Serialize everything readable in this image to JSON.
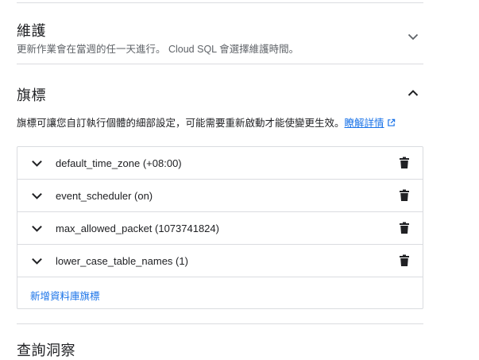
{
  "maintenance": {
    "title": "維護",
    "description": "更新作業會在當週的任一天進行。 Cloud SQL 會選擇維護時間。"
  },
  "flags": {
    "title": "旗標",
    "description": "旗標可讓您自訂執行個體的細部設定，可能需要重新啟動才能使變更生效。",
    "learn_more": "瞭解詳情",
    "items": [
      {
        "label": "default_time_zone (+08:00)"
      },
      {
        "label": "event_scheduler (on)"
      },
      {
        "label": "max_allowed_packet (1073741824)"
      },
      {
        "label": "lower_case_table_names (1)"
      }
    ],
    "add_label": "新增資料庫旗標"
  },
  "query_insights": {
    "title": "查詢洞察"
  },
  "icons": {
    "maintenance_toggle": "chevron-down-icon",
    "flags_toggle": "chevron-up-icon",
    "row_toggle": "chevron-down-icon",
    "delete": "trash-icon",
    "learn_more": "external-link-icon"
  },
  "colors": {
    "link": "#1a73e8",
    "divider": "#dadce0",
    "text": "#202124",
    "secondary_text": "#5f6368"
  }
}
